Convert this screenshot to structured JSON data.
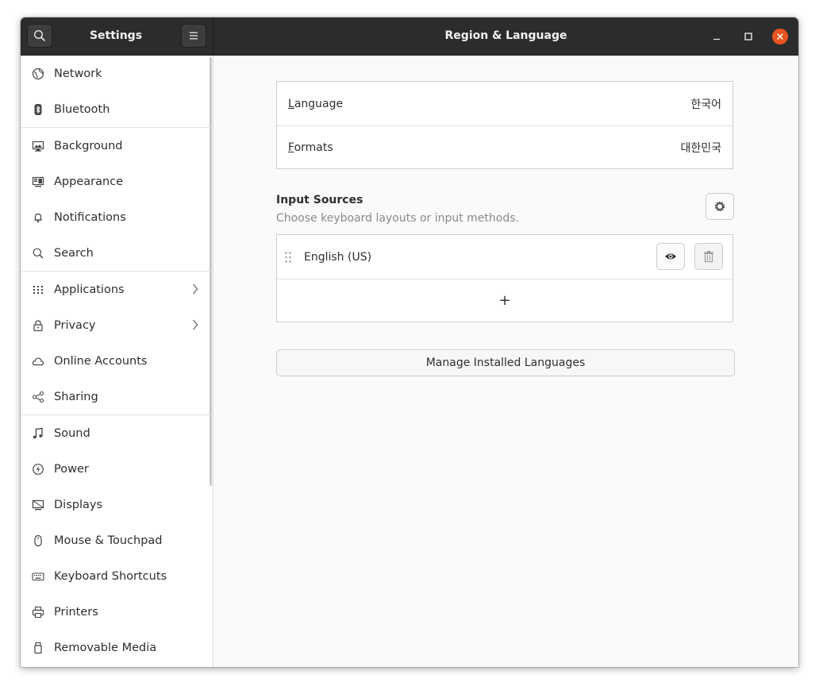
{
  "header": {
    "sidebar_title": "Settings",
    "page_title": "Region & Language"
  },
  "sidebar": {
    "items": [
      {
        "label": "Network",
        "icon": "globe-icon"
      },
      {
        "label": "Bluetooth",
        "icon": "bluetooth-icon"
      },
      {
        "label": "Background",
        "icon": "background-icon"
      },
      {
        "label": "Appearance",
        "icon": "appearance-icon"
      },
      {
        "label": "Notifications",
        "icon": "bell-icon"
      },
      {
        "label": "Search",
        "icon": "search-icon"
      },
      {
        "label": "Applications",
        "icon": "apps-grid-icon"
      },
      {
        "label": "Privacy",
        "icon": "lock-icon"
      },
      {
        "label": "Online Accounts",
        "icon": "cloud-icon"
      },
      {
        "label": "Sharing",
        "icon": "share-icon"
      },
      {
        "label": "Sound",
        "icon": "music-note-icon"
      },
      {
        "label": "Power",
        "icon": "power-icon"
      },
      {
        "label": "Displays",
        "icon": "display-icon"
      },
      {
        "label": "Mouse & Touchpad",
        "icon": "mouse-icon"
      },
      {
        "label": "Keyboard Shortcuts",
        "icon": "keyboard-icon"
      },
      {
        "label": "Printers",
        "icon": "printer-icon"
      },
      {
        "label": "Removable Media",
        "icon": "usb-icon"
      }
    ]
  },
  "region": {
    "language_label_mnemonic": "L",
    "language_label_rest": "anguage",
    "language_value": "한국어",
    "formats_label_mnemonic": "F",
    "formats_label_rest": "ormats",
    "formats_value": "대한민국"
  },
  "input_sources": {
    "title": "Input Sources",
    "subtitle": "Choose keyboard layouts or input methods.",
    "sources": [
      {
        "label": "English (US)"
      }
    ],
    "add_symbol": "+",
    "manage_label": "Manage Installed Languages"
  },
  "colors": {
    "accent": "#e95420",
    "header_bg": "#2c2c2c"
  }
}
